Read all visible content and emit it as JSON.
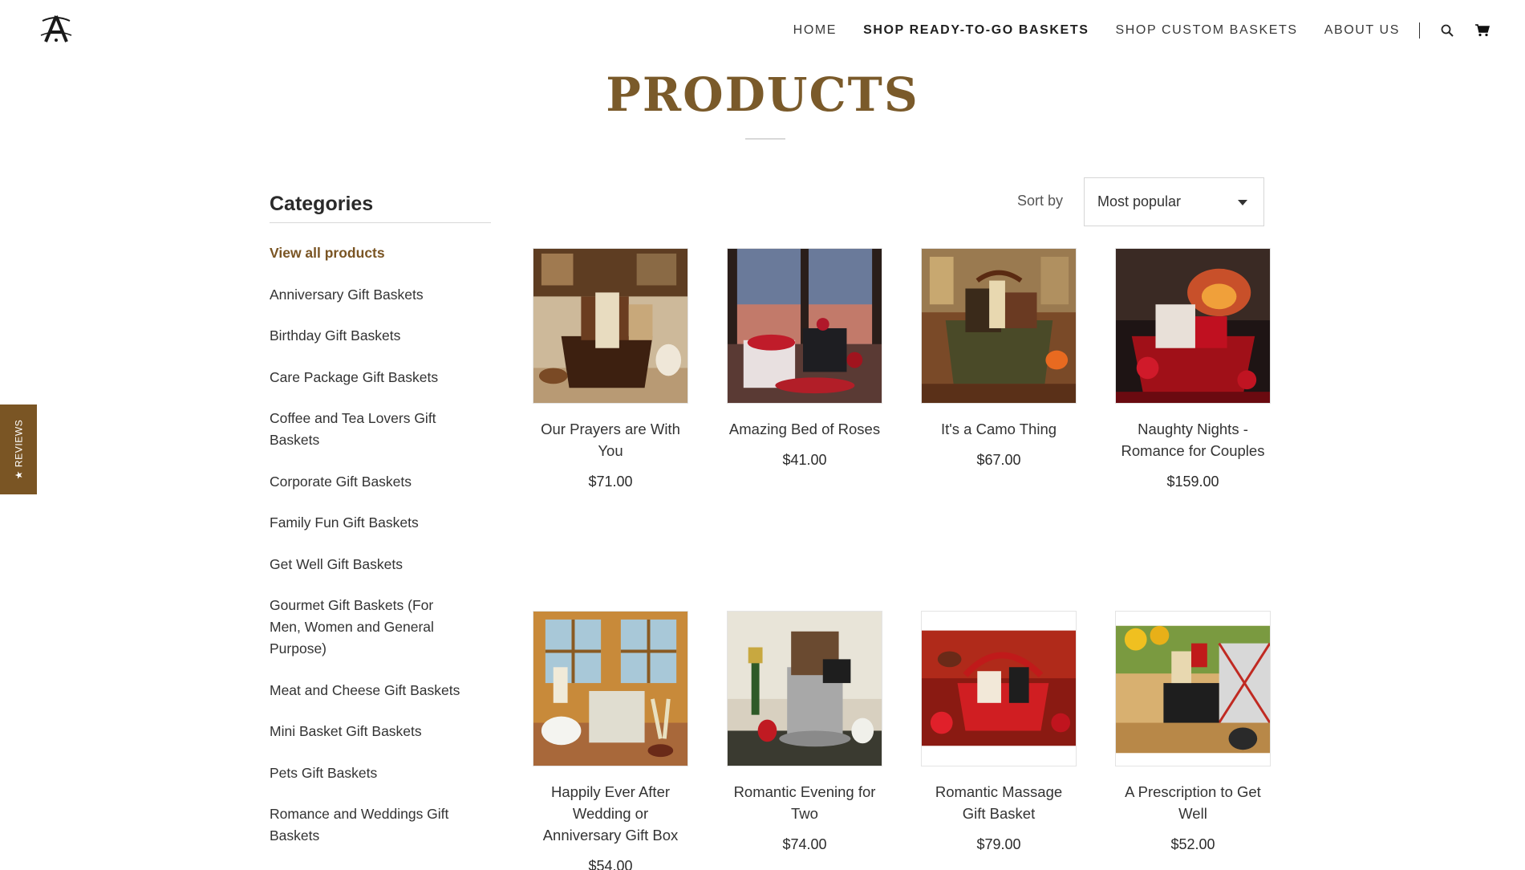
{
  "nav": {
    "items": [
      {
        "label": "HOME",
        "active": false
      },
      {
        "label": "SHOP READY-TO-GO BASKETS",
        "active": true
      },
      {
        "label": "SHOP CUSTOM BASKETS",
        "active": false
      },
      {
        "label": "ABOUT US",
        "active": false
      }
    ],
    "icons": [
      "search-icon",
      "cart-icon"
    ]
  },
  "page": {
    "title": "PRODUCTS"
  },
  "reviews_tab": {
    "label": "★ REVIEWS"
  },
  "sidebar": {
    "title": "Categories",
    "items": [
      {
        "label": "View all products",
        "active": true
      },
      {
        "label": "Anniversary Gift Baskets"
      },
      {
        "label": "Birthday Gift Baskets"
      },
      {
        "label": "Care Package Gift Baskets"
      },
      {
        "label": "Coffee and Tea Lovers Gift Baskets"
      },
      {
        "label": "Corporate Gift Baskets"
      },
      {
        "label": "Family Fun Gift Baskets"
      },
      {
        "label": "Get Well Gift Baskets"
      },
      {
        "label": "Gourmet Gift Baskets (For Men, Women and General Purpose)"
      },
      {
        "label": "Meat and Cheese Gift Baskets"
      },
      {
        "label": "Mini Basket Gift Baskets"
      },
      {
        "label": "Pets Gift Baskets"
      },
      {
        "label": "Romance and Weddings Gift Baskets"
      }
    ]
  },
  "sort": {
    "label": "Sort by",
    "selected": "Most popular"
  },
  "products": [
    {
      "name": "Our Prayers are With You",
      "price": "$71.00"
    },
    {
      "name": "Amazing Bed of Roses",
      "price": "$41.00"
    },
    {
      "name": "It's a Camo Thing",
      "price": "$67.00"
    },
    {
      "name": "Naughty Nights - Romance for Couples",
      "price": "$159.00"
    },
    {
      "name": "Happily Ever After Wedding or Anniversary Gift Box",
      "price": "$54.00"
    },
    {
      "name": "Romantic Evening for Two",
      "price": "$74.00"
    },
    {
      "name": "Romantic Massage Gift Basket",
      "price": "$79.00"
    },
    {
      "name": "A Prescription to Get Well",
      "price": "$52.00"
    }
  ],
  "colors": {
    "accent": "#7a5524",
    "title": "#7a5a2a",
    "text": "#333333"
  }
}
